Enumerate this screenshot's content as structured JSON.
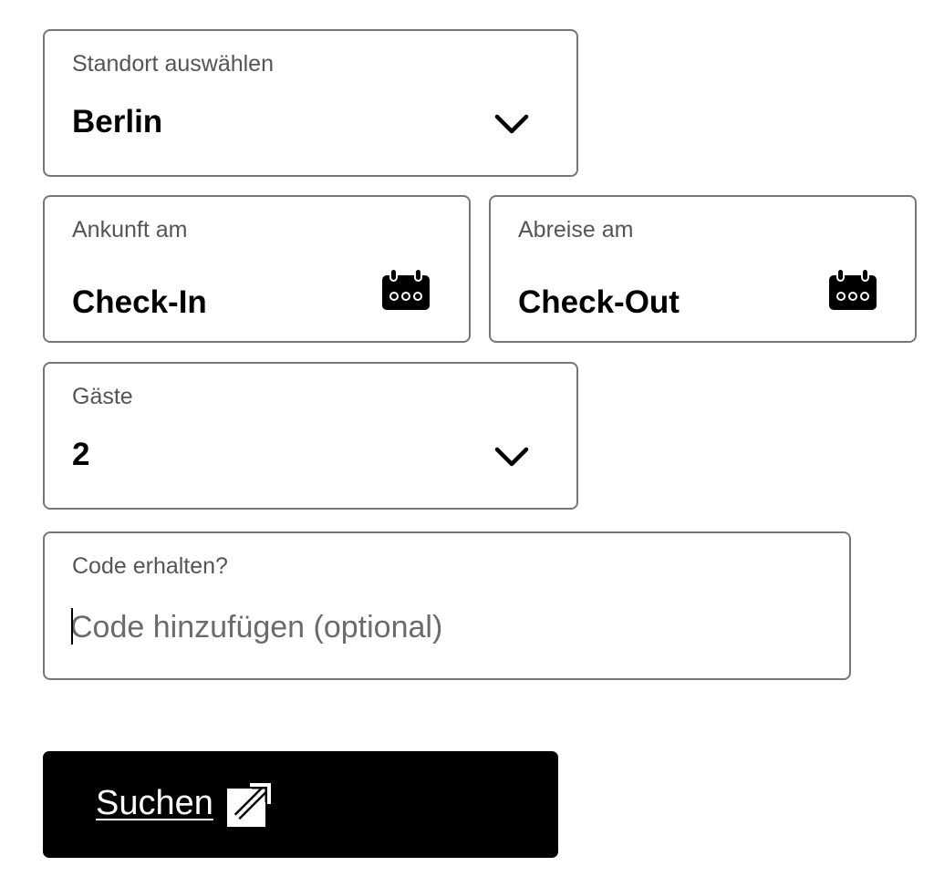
{
  "booking_form": {
    "location": {
      "label": "Standort auswählen",
      "value": "Berlin",
      "icon": "chevron-down-icon"
    },
    "checkin": {
      "label": "Ankunft am",
      "value": "Check-In",
      "icon": "calendar-icon"
    },
    "checkout": {
      "label": "Abreise am",
      "value": "Check-Out",
      "icon": "calendar-icon"
    },
    "guests": {
      "label": "Gäste",
      "value": "2",
      "icon": "chevron-down-icon"
    },
    "code": {
      "label": "Code erhalten?",
      "value": "",
      "placeholder": "Code hinzufügen (optional)"
    },
    "search_button": {
      "label": "Suchen",
      "icon": "external-link-icon"
    }
  },
  "colors": {
    "border": "#767676",
    "label_text": "#555555",
    "placeholder_text": "#6b6b6b",
    "button_background": "#000000",
    "button_text": "#ffffff"
  }
}
